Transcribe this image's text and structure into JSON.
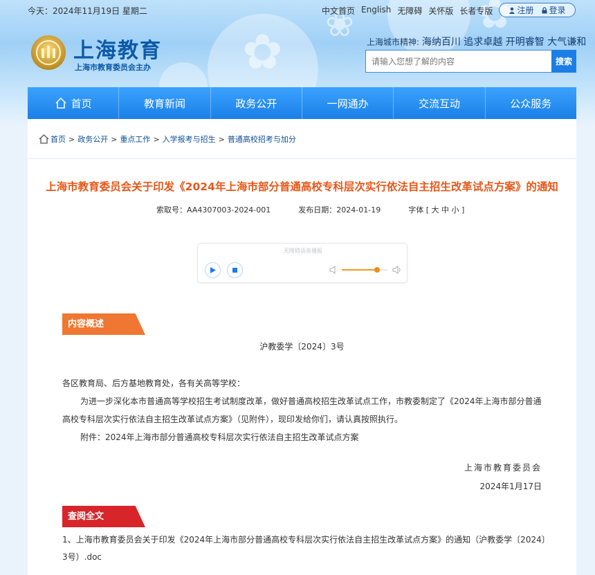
{
  "topbar": {
    "date": "今天：2024年11月19日 星期二",
    "links": [
      "中文首页",
      "English",
      "无障碍",
      "关怀版",
      "长者专版"
    ],
    "register": "注册",
    "login": "登录"
  },
  "logo": {
    "title": "上海教育",
    "subtitle": "上海市教育委员会主办"
  },
  "spirit": {
    "prefix": "上海城市精神: ",
    "slogan": "海纳百川 追求卓越 开明睿智 大气谦和"
  },
  "search": {
    "placeholder": "请输入您想了解的内容",
    "button": "搜索"
  },
  "nav": [
    "首页",
    "教育新闻",
    "政务公开",
    "一网通办",
    "交流互动",
    "公众服务"
  ],
  "breadcrumb": [
    "首页",
    "政务公开",
    "重点工作",
    "入学报考与招生",
    "普通高校招考与加分"
  ],
  "article": {
    "title": "上海市教育委员会关于印发《2024年上海市部分普通高校专科层次实行依法自主招生改革试点方案》的通知",
    "index_no": "索取号：AA4307003-2024-001",
    "pub_date": "发布日期：2024-01-19",
    "font_size": "字体 [ 大 中 小 ]",
    "player_caption": "无障碍语音播报",
    "volume_level": 0.78,
    "summary_tag": "内容概述",
    "doc_no": "沪教委学〔2024〕3号",
    "salutation": "各区教育局、后方基地教育处，各有关高等学校：",
    "para1": "为进一步深化本市普通高等学校招生考试制度改革，做好普通高校招生改革试点工作，市教委制定了《2024年上海市部分普通高校专科层次实行依法自主招生改革试点方案》（见附件），现印发给你们，请认真按照执行。",
    "attachment_line": "附件：2024年上海市部分普通高校专科层次实行依法自主招生改革试点方案",
    "signer": "上海市教育委员会",
    "sign_date": "2024年1月17日",
    "fulltext_tag": "查阅全文",
    "fulltext_link": "1、上海市教育委员会关于印发《2024年上海市部分普通高校专科层次实行依法自主招生改革试点方案》的通知（沪教委学〔2024〕3号）.doc"
  }
}
